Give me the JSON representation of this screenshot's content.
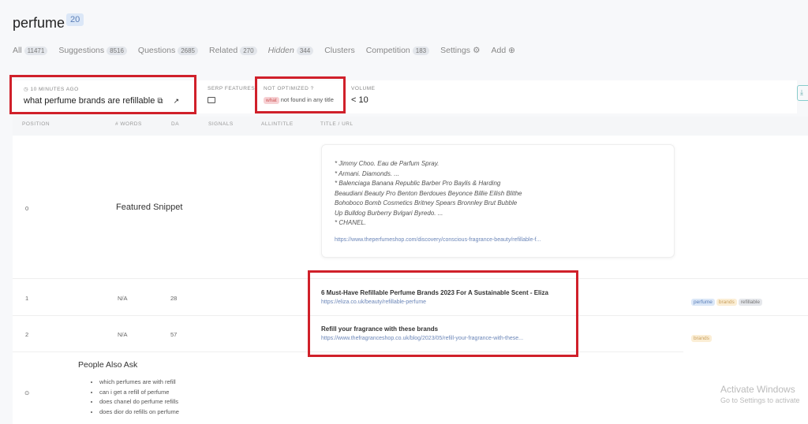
{
  "page": {
    "title": "perfume",
    "count": "20"
  },
  "tabs": [
    {
      "label": "All",
      "count": "11471"
    },
    {
      "label": "Suggestions",
      "count": "8516"
    },
    {
      "label": "Questions",
      "count": "2685"
    },
    {
      "label": "Related",
      "count": "270"
    },
    {
      "label": "Hidden",
      "count": "344"
    },
    {
      "label": "Clusters"
    },
    {
      "label": "Competition",
      "count": "183"
    },
    {
      "label": "Settings"
    },
    {
      "label": "Add"
    }
  ],
  "header": {
    "time": "10 MINUTES AGO",
    "keyword": "what perfume brands are refillable",
    "serp_label": "SERP FEATURES",
    "notopt_label": "NOT OPTIMIZED ?",
    "notopt_word": "what",
    "notopt_text": "not found in any title",
    "volume_label": "VOLUME",
    "volume": "< 10"
  },
  "columns": [
    "POSITION",
    "# WORDS",
    "DA",
    "SIGNALS",
    "ALLINTITLE",
    "TITLE / URL"
  ],
  "featured": {
    "position": "0",
    "label": "Featured Snippet",
    "lines": [
      "* Jimmy Choo. Eau de Parfum Spray.",
      "* Armani. Diamonds. ...",
      "* Balenciaga Banana Republic Barber Pro Baylis & Harding",
      "Beaudiani Beauty Pro Benton Berdoues Beyonce Billie Eilish Blithe",
      "Bohoboco Bomb Cosmetics Britney Spears Bronnley Brut Bubble",
      "Up Bulldog Burberry Bvlgari Byredo. ...",
      "* CHANEL."
    ],
    "url": "https://www.theperfumeshop.com/discovery/conscious-fragrance-beauty/refillable-f..."
  },
  "rows": [
    {
      "position": "1",
      "words": "N/A",
      "da": "28",
      "title": "6 Must-Have Refillable Perfume Brands 2023 For A Sustainable Scent - Eliza",
      "url": "https://eliza.co.uk/beauty/refillable-perfume",
      "tags": [
        "perfume",
        "brands",
        "refillable"
      ]
    },
    {
      "position": "2",
      "words": "N/A",
      "da": "57",
      "title": "Refill your fragrance with these brands",
      "url": "https://www.thefragranceshop.co.uk/blog/2023/05/refill-your-fragrance-with-these...",
      "tags": [
        "brands"
      ]
    }
  ],
  "paa": {
    "title": "People Also Ask",
    "items": [
      "which perfumes are with refill",
      "can i get a refill of perfume",
      "does chanel do perfume refills",
      "does dior do refills on perfume"
    ]
  },
  "watermark": {
    "line1": "Activate Windows",
    "line2": "Go to Settings to activate"
  },
  "colors": {
    "highlight": "#d0202a",
    "tag_blue": "#dbe7f7",
    "tag_orange": "#fbeed5",
    "tag_gray": "#e5e7eb"
  }
}
